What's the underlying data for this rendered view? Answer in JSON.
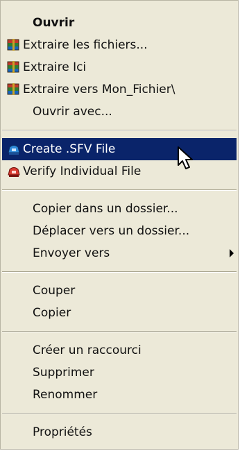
{
  "menu": {
    "items": [
      {
        "label": "Ouvrir"
      },
      {
        "label": "Extraire les fichiers...",
        "icon": "winrar-archive-icon"
      },
      {
        "label": "Extraire Ici",
        "icon": "winrar-archive-icon"
      },
      {
        "label": "Extraire vers Mon_Fichier\\",
        "icon": "winrar-archive-icon"
      },
      {
        "label": "Ouvrir avec..."
      },
      {
        "label": "Create .SFV File",
        "icon": "sfv-create-icon"
      },
      {
        "label": "Verify Individual File",
        "icon": "sfv-verify-icon"
      },
      {
        "label": "Copier dans un dossier..."
      },
      {
        "label": "Déplacer vers un dossier..."
      },
      {
        "label": "Envoyer vers"
      },
      {
        "label": "Couper"
      },
      {
        "label": "Copier"
      },
      {
        "label": "Créer un raccourci"
      },
      {
        "label": "Supprimer"
      },
      {
        "label": "Renommer"
      },
      {
        "label": "Propriétés"
      }
    ]
  },
  "colors": {
    "menu_bg": "#ece9d8",
    "highlight_bg": "#0a246a",
    "highlight_text": "#ffffff"
  }
}
